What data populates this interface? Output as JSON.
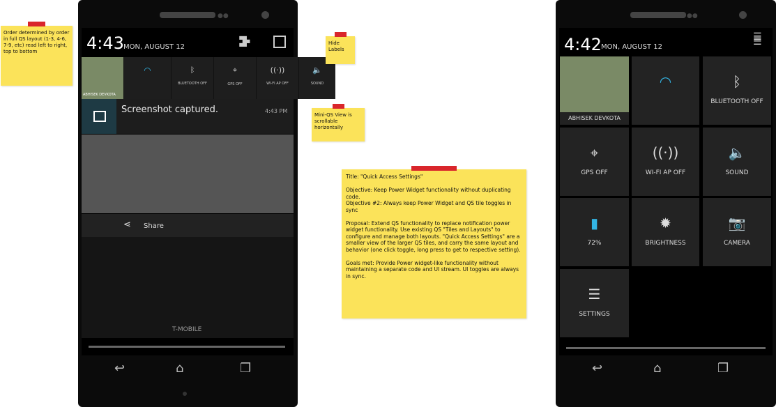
{
  "notes": {
    "order": "Order determined by order in full QS layout (1-3, 4-6, 7-9, etc) read left to right, top to bottom",
    "hide_labels": "Hide Labels",
    "mini_qs": "Mini-QS View is scrollable horizontally",
    "main": "Title: \"Quick Access Settings\"\n\nObjective: Keep Power Widget functionality without duplicating code.\nObjective #2: Always keep Power Widget and QS tile toggles in sync\n\nProposal: Extend QS functionality to replace notification power widget functionality. Use existing QS \"Tiles and Layouts\" to configure and manage both layouts. \"Quick Access Settings\" are a smaller view of the larger QS tiles, and carry the same layout and behavior (one click toggle, long press to get to respective setting).\n\nGoals met: Provide Power widget-like functionality without maintaining a separate code and UI stream. UI toggles are always in sync."
  },
  "left_phone": {
    "time": "4:43",
    "date": "MON, AUGUST 12",
    "mini_tiles": [
      {
        "label": "ABHISEK DEVKOTA",
        "icon": "avatar"
      },
      {
        "label": "",
        "icon": "wifi-icon"
      },
      {
        "label": "BLUETOOTH OFF",
        "icon": "bluetooth-icon"
      },
      {
        "label": "GPS OFF",
        "icon": "gps-icon"
      },
      {
        "label": "WI-FI AP OFF",
        "icon": "hotspot-icon"
      },
      {
        "label": "SOUND",
        "icon": "sound-icon"
      }
    ],
    "notification": {
      "title": "Screenshot captured.",
      "time": "4:43 PM",
      "action": "Share"
    },
    "carrier": "T-MOBILE"
  },
  "right_phone": {
    "time": "4:42",
    "date": "MON, AUGUST 12",
    "tiles": [
      {
        "label": "ABHISEK DEVKOTA",
        "icon": "avatar"
      },
      {
        "label": "",
        "icon": "wifi-icon"
      },
      {
        "label": "BLUETOOTH OFF",
        "icon": "bluetooth-icon"
      },
      {
        "label": "GPS OFF",
        "icon": "gps-icon"
      },
      {
        "label": "WI-FI AP OFF",
        "icon": "hotspot-icon"
      },
      {
        "label": "SOUND",
        "icon": "sound-icon"
      },
      {
        "label": "72%",
        "icon": "battery-icon"
      },
      {
        "label": "BRIGHTNESS",
        "icon": "brightness-icon"
      },
      {
        "label": "CAMERA",
        "icon": "camera-icon"
      },
      {
        "label": "SETTINGS",
        "icon": "settings-icon"
      }
    ]
  },
  "colors": {
    "accent": "#33b5e5",
    "note": "#fbe35a",
    "tape": "#d9262b"
  }
}
